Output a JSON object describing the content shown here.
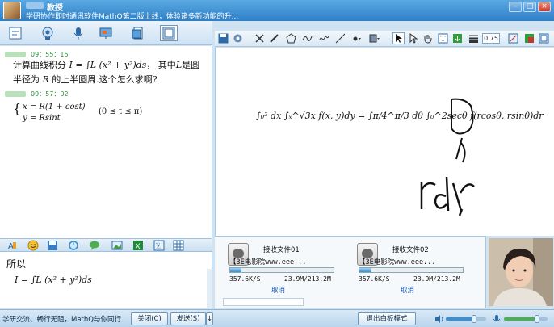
{
  "titlebar": {
    "role": "教授",
    "subtitle": "学研协作即时通讯软件MathQ第二版上线，体验诸多新功能的升..."
  },
  "chat": {
    "messages": [
      {
        "time": "09：55：15",
        "text_line1": "计算曲线积分",
        "text_mid": "， 其中",
        "text_end": "是圆",
        "text_line2": "半径为",
        "text_line2b": "的上半圆周.这个怎么求啊?",
        "var_L": "L",
        "var_R": "R"
      },
      {
        "time": "09：57：02"
      }
    ],
    "integral": "I = ∫L (x² + y²)ds",
    "param_x": "x = R(1 + cost)",
    "param_y": "y = Rsint",
    "param_range": "(0 ≤ t ≤ π)"
  },
  "input": {
    "text": "所以",
    "integral": "I = ∫L (x² + y²)ds"
  },
  "bottom": {
    "slogan": "学研交流、畅行无阻，MathQ与你同行",
    "close_label": "关闭(C)",
    "send_label": "发送(S)",
    "dropdown_label": "↓",
    "exit_whiteboard_label": "退出白板模式",
    "speaker_volume": 0.7,
    "mic_volume": 0.75
  },
  "whiteboard": {
    "zoom": "0.75",
    "formula": "∫₀² dx ∫ₓ^√3x f(x, y)dy = ∫π/4^π/3 dθ ∫₀^2secθ f(rcosθ, rsinθ)dr",
    "handwriting": "rdr"
  },
  "files": [
    {
      "name": "接收文件01",
      "title": "【3E电影院www.eee...",
      "speed": "357.6K/S",
      "size": "23.9M/213.2M",
      "progress": 0.11,
      "cancel": "取消"
    },
    {
      "name": "接收文件02",
      "title": "【3E电影院www.eee...",
      "speed": "357.6K/S",
      "size": "23.9M/213.2M",
      "progress": 0.11,
      "cancel": "取消"
    }
  ],
  "colors": {
    "title_blue": "#2f7fc6",
    "accent_green": "#2a8f3a",
    "link_blue": "#1155bb"
  }
}
